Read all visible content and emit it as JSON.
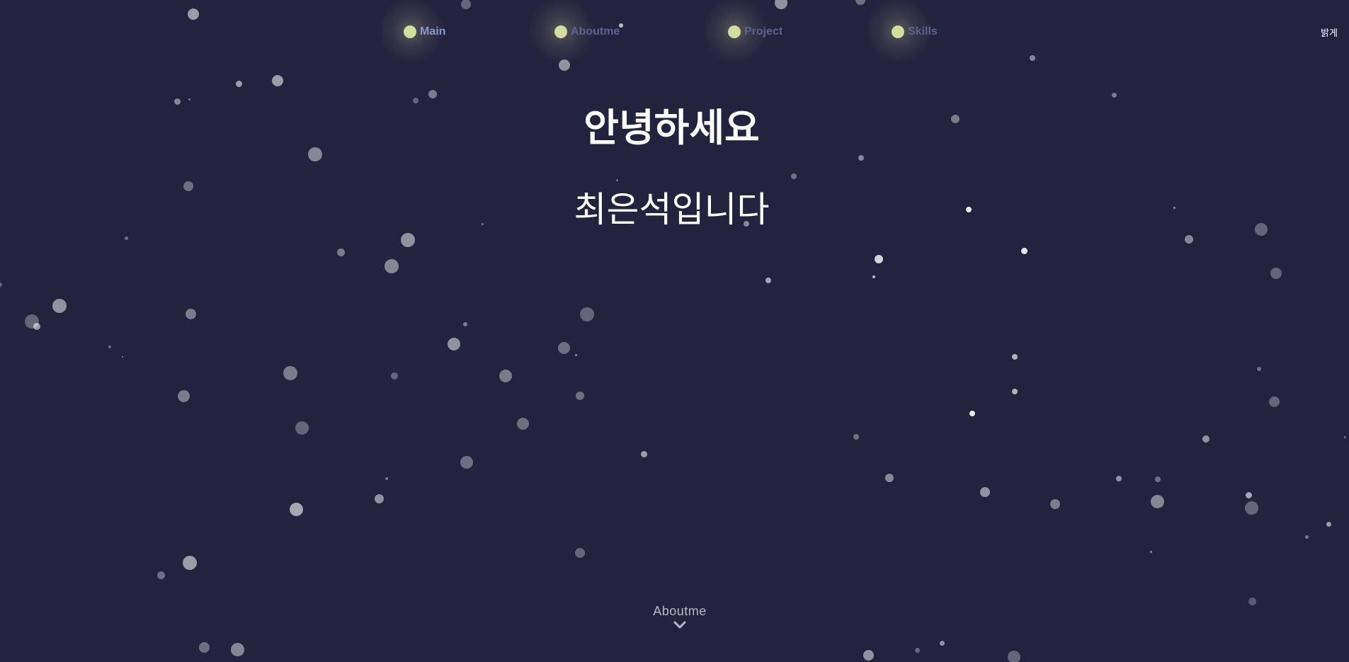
{
  "nav": {
    "items": [
      {
        "label": "Main",
        "active": true
      },
      {
        "label": "Aboutme",
        "active": false
      },
      {
        "label": "Project",
        "active": false
      },
      {
        "label": "Skills",
        "active": false
      }
    ],
    "theme_toggle_label": "밝게"
  },
  "hero": {
    "greeting": "안녕하세요",
    "name_line": "최은석입니다"
  },
  "scroll_hint": {
    "label": "Aboutme",
    "icon": "chevron-down-icon"
  },
  "colors": {
    "background": "#24233f",
    "nav_bulb": "#d4dca0",
    "nav_label": "#5a6490",
    "nav_label_active": "#8a97d0",
    "text": "#ffffff"
  }
}
